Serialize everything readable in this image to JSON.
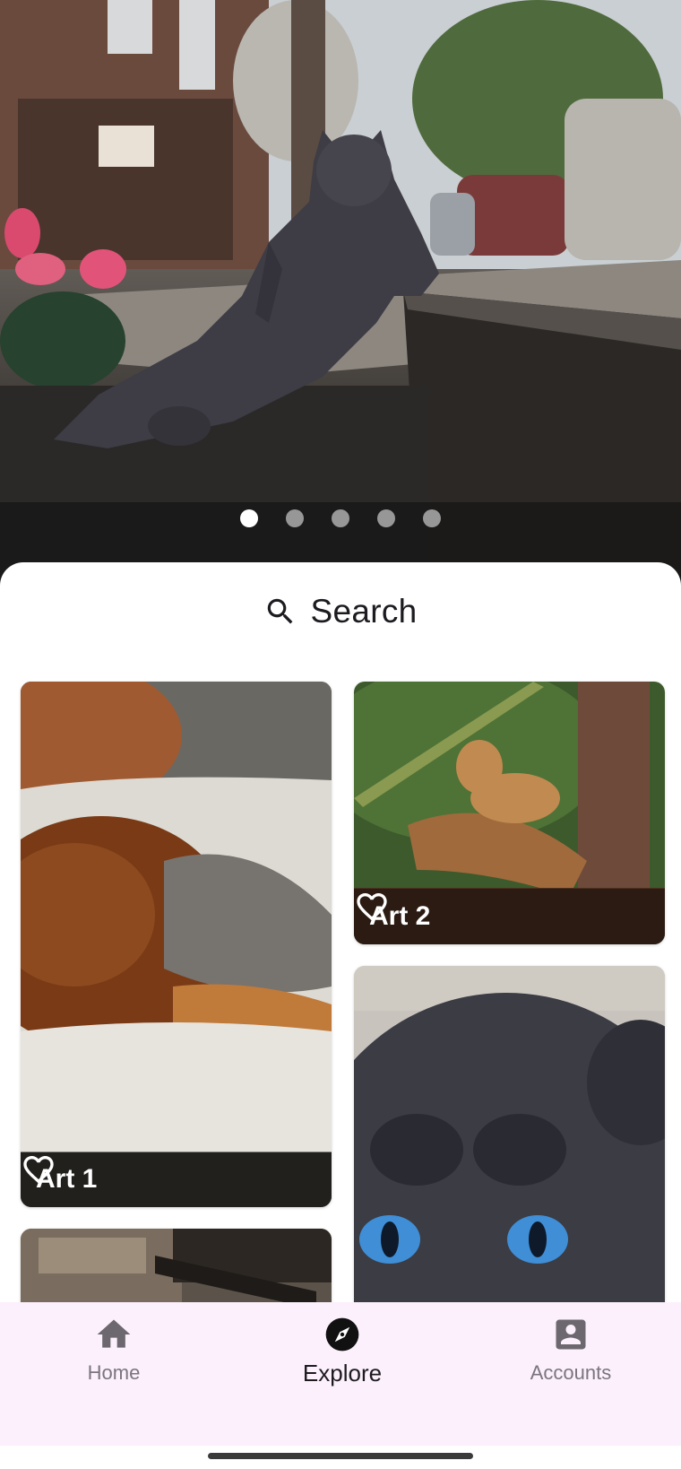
{
  "carousel": {
    "slide_count": 5,
    "active_index": 0
  },
  "search": {
    "label": "Search",
    "icon": "search-icon"
  },
  "gallery": {
    "cards": [
      {
        "title": "Art 1",
        "icon": "heart-outline-icon"
      },
      {
        "title": "Art 2",
        "icon": "heart-outline-icon"
      },
      {
        "title": "",
        "icon": ""
      },
      {
        "title": "",
        "icon": ""
      }
    ]
  },
  "nav": {
    "items": [
      {
        "label": "Home",
        "icon": "home-icon",
        "active": false
      },
      {
        "label": "Explore",
        "icon": "explore-compass-icon",
        "active": true
      },
      {
        "label": "Accounts",
        "icon": "account-box-icon",
        "active": false
      }
    ]
  },
  "colors": {
    "nav_background": "#fbf0fb",
    "inactive_label": "#7a757f",
    "active_label": "#1d1b20"
  }
}
